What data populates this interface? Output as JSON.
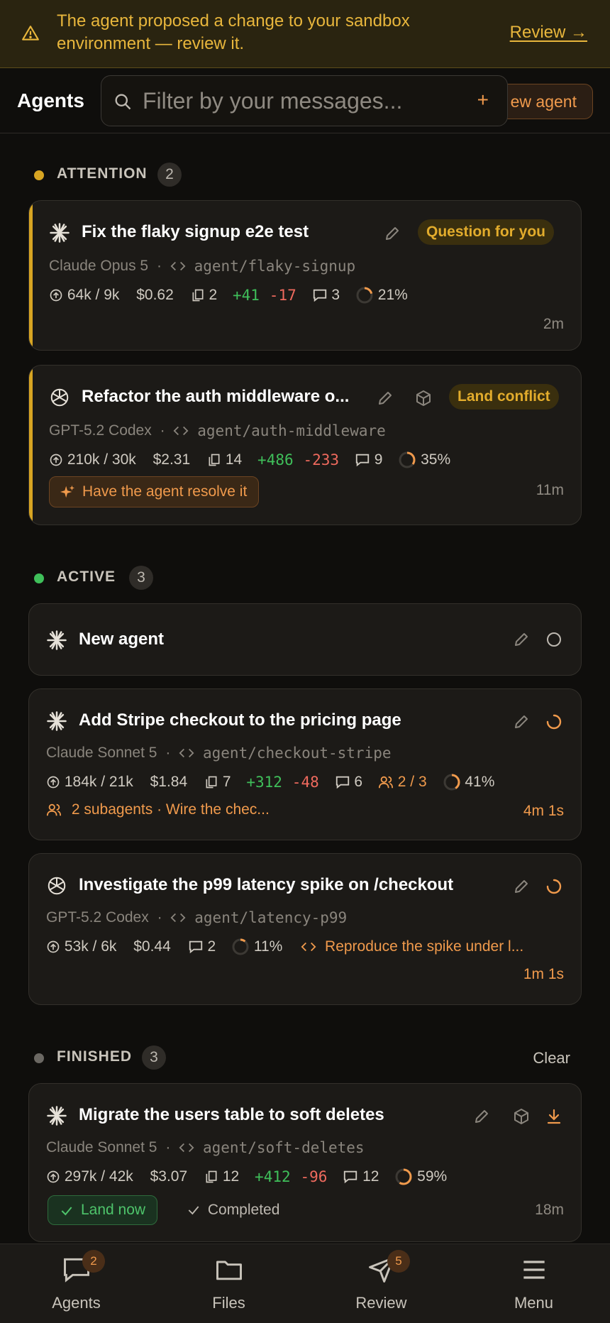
{
  "banner": {
    "text": "The agent proposed a change to your sandbox environment — review it.",
    "review_label": "Review →"
  },
  "header": {
    "title": "Agents",
    "new_agent_label": "ew agent"
  },
  "search": {
    "placeholder": "Filter by your messages...",
    "plus": "+"
  },
  "sections": {
    "attention": {
      "label": "ATTENTION",
      "count": "2",
      "color": "#d8a522"
    },
    "active": {
      "label": "ACTIVE",
      "count": "3",
      "color": "#3fbf5a"
    },
    "finished": {
      "label": "FINISHED",
      "count": "3",
      "color": "#6b6863",
      "clear_label": "Clear"
    }
  },
  "cards": [
    {
      "title": "Fix the flaky signup e2e test",
      "badge": "Question for you",
      "model": "Claude Opus 5",
      "branch": "agent/flaky-signup",
      "tokens": "64k / 9k",
      "cost": "$0.62",
      "files": "2",
      "added": "+41",
      "removed": "-17",
      "comments": "3",
      "progress_label": "21%",
      "progress": 0.21,
      "time": "2m"
    },
    {
      "title": "Refactor the auth middleware o...",
      "badge": "Land conflict",
      "model": "GPT-5.2 Codex",
      "branch": "agent/auth-middleware",
      "tokens": "210k / 30k",
      "cost": "$2.31",
      "files": "14",
      "added": "+486",
      "removed": "-233",
      "comments": "9",
      "progress_label": "35%",
      "progress": 0.35,
      "action": "Have the agent resolve it",
      "time": "11m"
    },
    {
      "title": "New agent"
    },
    {
      "title": "Add Stripe checkout to the pricing page",
      "model": "Claude Sonnet 5",
      "branch": "agent/checkout-stripe",
      "tokens": "184k / 21k",
      "cost": "$1.84",
      "files": "7",
      "added": "+312",
      "removed": "-48",
      "comments": "6",
      "agents": "2 / 3",
      "progress_label": "41%",
      "progress": 0.41,
      "subagents": "2 subagents · Wire the chec...",
      "time": "4m 1s"
    },
    {
      "title": "Investigate the p99 latency spike on /checkout",
      "model": "GPT-5.2 Codex",
      "branch": "agent/latency-p99",
      "tokens": "53k / 6k",
      "cost": "$0.44",
      "comments": "2",
      "progress_label": "11%",
      "progress": 0.11,
      "task": "Reproduce the spike under l...",
      "time": "1m 1s"
    },
    {
      "title": "Migrate the users table to soft deletes",
      "model": "Claude Sonnet 5",
      "branch": "agent/soft-deletes",
      "tokens": "297k / 42k",
      "cost": "$3.07",
      "files": "12",
      "added": "+412",
      "removed": "-96",
      "comments": "12",
      "progress_label": "59%",
      "progress": 0.59,
      "land_label": "Land now",
      "status": "Completed",
      "time": "18m"
    }
  ],
  "nav": {
    "agents": {
      "label": "Agents",
      "badge": "2"
    },
    "files": {
      "label": "Files"
    },
    "review": {
      "label": "Review",
      "badge": "5"
    },
    "menu": {
      "label": "Menu"
    }
  },
  "colors": {
    "accent": "#f09a4c",
    "warning": "#e8b63c",
    "success": "#3fbf5a",
    "danger": "#ef6a5e"
  }
}
